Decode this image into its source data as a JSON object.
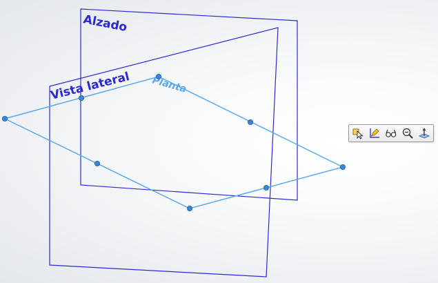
{
  "viewport": {
    "planes": {
      "front": {
        "label": "Alzado"
      },
      "right": {
        "label": "Vista lateral"
      },
      "top": {
        "label": "Planta"
      }
    }
  },
  "context_toolbar": {
    "items": [
      {
        "icon": "select-other-icon"
      },
      {
        "icon": "edit-sketch-icon"
      },
      {
        "icon": "hide-show-icon"
      },
      {
        "icon": "zoom-to-selection-icon"
      },
      {
        "icon": "normal-to-icon"
      }
    ]
  },
  "colors": {
    "plane_edge": "#2a2ad0",
    "selected_plane": "#5aa8ee",
    "handle": "#3b86d6"
  }
}
